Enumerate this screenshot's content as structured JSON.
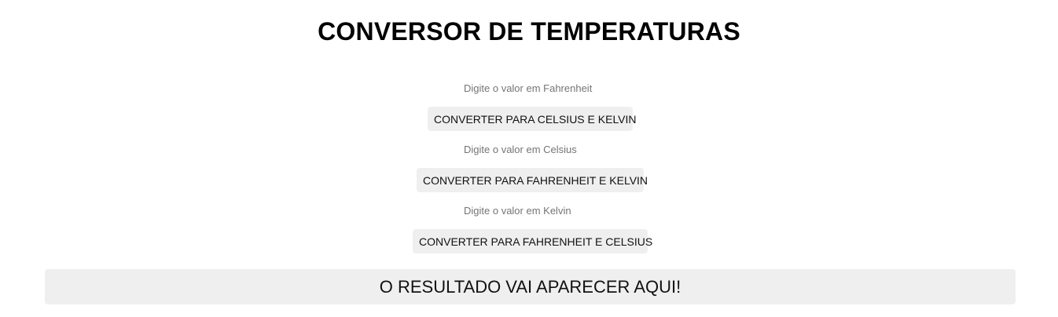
{
  "header": {
    "title": "CONVERSOR DE TEMPERATURAS"
  },
  "fahrenheit": {
    "placeholder": "Digite o valor em Fahrenheit",
    "value": "",
    "button_label": "CONVERTER PARA CELSIUS E KELVIN"
  },
  "celsius": {
    "placeholder": "Digite o valor em Celsius",
    "value": "",
    "button_label": "CONVERTER PARA FAHRENHEIT E KELVIN"
  },
  "kelvin": {
    "placeholder": "Digite o valor em Kelvin",
    "value": "",
    "button_label": "CONVERTER PARA FAHRENHEIT E CELSIUS"
  },
  "result": {
    "text": "O RESULTADO VAI APARECER AQUI!"
  }
}
